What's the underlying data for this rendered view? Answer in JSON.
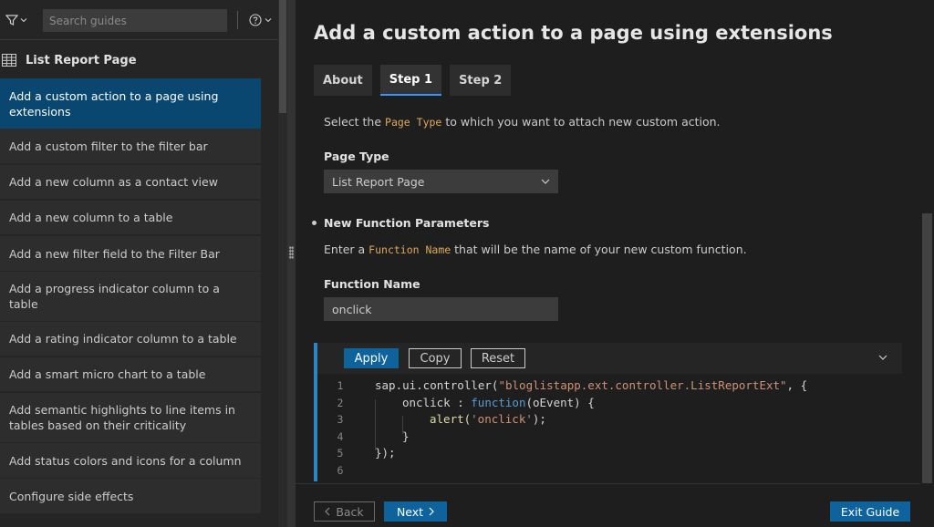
{
  "sidebar": {
    "search": {
      "placeholder": "Search guides",
      "value": ""
    },
    "section_title": "List Report Page",
    "items": [
      {
        "label": "Add a custom action to a page using extensions",
        "active": true
      },
      {
        "label": "Add a custom filter to the filter bar"
      },
      {
        "label": "Add a new column as a contact view"
      },
      {
        "label": "Add a new column to a table"
      },
      {
        "label": "Add a new filter field to the Filter Bar"
      },
      {
        "label": "Add a progress indicator column to a table"
      },
      {
        "label": "Add a rating indicator column to a table"
      },
      {
        "label": "Add a smart micro chart to a table"
      },
      {
        "label": "Add semantic highlights to line items in tables based on their criticality"
      },
      {
        "label": "Add status colors and icons for a column"
      },
      {
        "label": "Configure side effects"
      }
    ]
  },
  "main": {
    "title": "Add a custom action to a page using extensions",
    "tabs": [
      {
        "label": "About",
        "active": false
      },
      {
        "label": "Step 1",
        "active": true
      },
      {
        "label": "Step 2",
        "active": false
      }
    ],
    "intro": {
      "pre": "Select the ",
      "code": "Page Type",
      "post": " to which you want to attach new custom action."
    },
    "page_type_label": "Page Type",
    "page_type_value": "List Report Page",
    "bullet_heading": "New Function Parameters",
    "fn_intro": {
      "pre": "Enter a ",
      "code": "Function Name",
      "post": " that will be the name of your new custom function."
    },
    "function_name_label": "Function Name",
    "function_name_value": "onclick",
    "code_toolbar": {
      "apply": "Apply",
      "copy": "Copy",
      "reset": "Reset"
    },
    "code_lines": [
      {
        "n": "1"
      },
      {
        "n": "2"
      },
      {
        "n": "3"
      },
      {
        "n": "4"
      },
      {
        "n": "5"
      },
      {
        "n": "6"
      }
    ],
    "code_tokens": {
      "l1_a": "sap.ui.controller(",
      "l1_b": "\"bloglistapp.ext.controller.ListReportExt\"",
      "l1_c": ", {",
      "l2_a": "onclick : ",
      "l2_b": "function",
      "l2_c": "(oEvent) {",
      "l3_a": "alert(",
      "l3_b": "'onclick'",
      "l3_c": ");",
      "l4_a": "}",
      "l5_a": "});"
    },
    "footer": {
      "back": "Back",
      "next": "Next",
      "exit": "Exit Guide"
    }
  },
  "colors": {
    "accent": "#0e639c",
    "active_item": "#094771",
    "inline_code": "#e0a85c"
  }
}
